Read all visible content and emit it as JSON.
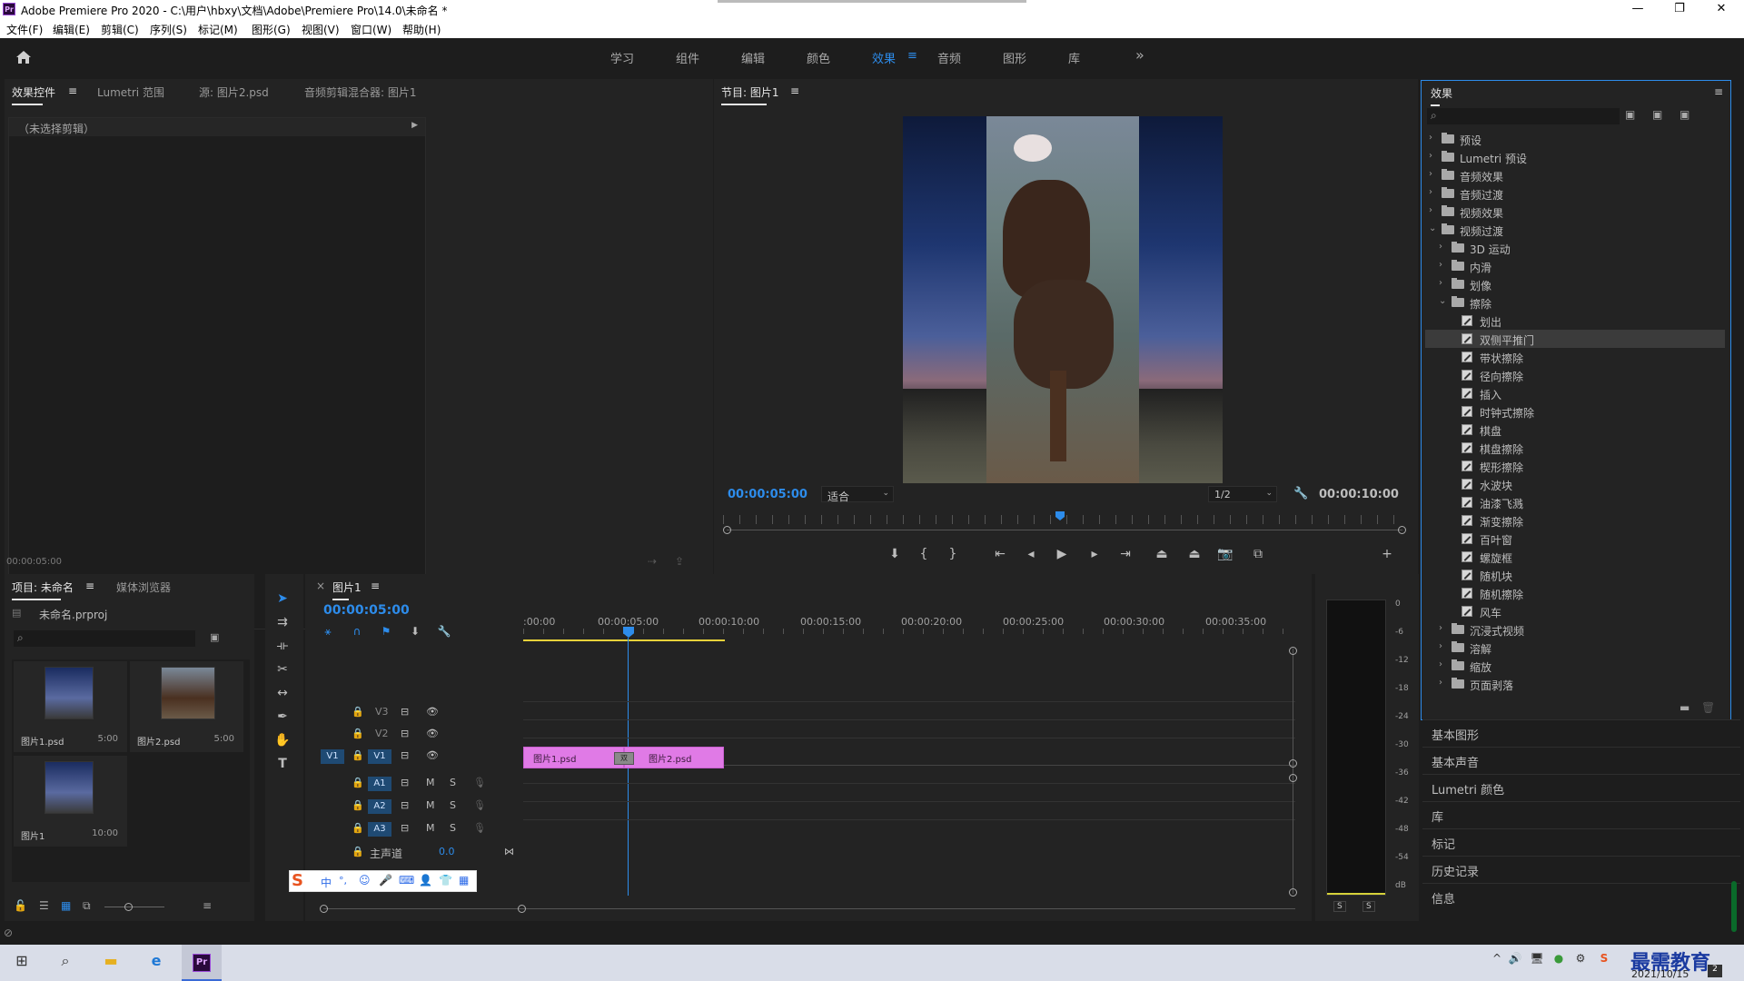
{
  "window": {
    "title": "Adobe Premiere Pro 2020 - C:\\用户\\hbxy\\文档\\Adobe\\Premiere Pro\\14.0\\未命名 *",
    "minimize": "—",
    "maximize": "❐",
    "close": "✕"
  },
  "menu": [
    "文件(F)",
    "编辑(E)",
    "剪辑(C)",
    "序列(S)",
    "标记(M)",
    "图形(G)",
    "视图(V)",
    "窗口(W)",
    "帮助(H)"
  ],
  "workspaces": {
    "items": [
      "学习",
      "组件",
      "编辑",
      "颜色",
      "效果",
      "音频",
      "图形",
      "库"
    ],
    "active": "效果",
    "more": "»",
    "menu_icon": "≡"
  },
  "effect_controls": {
    "tabs": [
      "效果控件",
      "Lumetri 范围",
      "源: 图片2.psd",
      "音频剪辑混合器: 图片1"
    ],
    "menu_icon": "≡",
    "no_clip": "（未选择剪辑）",
    "timecode": "00:00:05:00"
  },
  "program": {
    "title": "节目: 图片1",
    "menu_icon": "≡",
    "timecode": "00:00:05:00",
    "fit": "适合",
    "quality": "1/2",
    "duration": "00:00:10:00"
  },
  "project": {
    "tabs": [
      "项目: 未命名",
      "媒体浏览器"
    ],
    "menu_icon": "≡",
    "file": "未命名.prproj",
    "items": [
      {
        "name": "图片1.psd",
        "dur": "5:00"
      },
      {
        "name": "图片2.psd",
        "dur": "5:00"
      },
      {
        "name": "图片1",
        "dur": "10:00"
      }
    ]
  },
  "timeline": {
    "title": "图片1",
    "menu_icon": "≡",
    "close": "×",
    "timecode": "00:00:05:00",
    "ruler": [
      ":00:00",
      "00:00:05:00",
      "00:00:10:00",
      "00:00:15:00",
      "00:00:20:00",
      "00:00:25:00",
      "00:00:30:00",
      "00:00:35:00"
    ],
    "video_tracks": [
      "V3",
      "V2",
      "V1"
    ],
    "audio_tracks": [
      "A1",
      "A2",
      "A3"
    ],
    "src_patch": "V1",
    "master": "主声道",
    "master_val": "0.0",
    "clip1": "图片1.psd",
    "clip2": "图片2.psd",
    "transition_badge": "双"
  },
  "meter": {
    "scale": [
      "0",
      "-6",
      "-12",
      "-18",
      "-24",
      "-30",
      "-36",
      "-42",
      "-48",
      "-54",
      "dB"
    ],
    "solo": [
      "S",
      "S"
    ]
  },
  "effects": {
    "title": "效果",
    "menu_icon": "≡",
    "tree": [
      {
        "label": "预设",
        "level": 0,
        "type": "folder",
        "open": false
      },
      {
        "label": "Lumetri 预设",
        "level": 0,
        "type": "folder",
        "open": false
      },
      {
        "label": "音频效果",
        "level": 0,
        "type": "folder",
        "open": false
      },
      {
        "label": "音频过渡",
        "level": 0,
        "type": "folder",
        "open": false
      },
      {
        "label": "视频效果",
        "level": 0,
        "type": "folder",
        "open": false
      },
      {
        "label": "视频过渡",
        "level": 0,
        "type": "folder",
        "open": true
      },
      {
        "label": "3D 运动",
        "level": 1,
        "type": "folder",
        "open": false
      },
      {
        "label": "内滑",
        "level": 1,
        "type": "folder",
        "open": false
      },
      {
        "label": "划像",
        "level": 1,
        "type": "folder",
        "open": false
      },
      {
        "label": "擦除",
        "level": 1,
        "type": "folder",
        "open": true
      },
      {
        "label": "划出",
        "level": 2,
        "type": "fx"
      },
      {
        "label": "双侧平推门",
        "level": 2,
        "type": "fx",
        "selected": true
      },
      {
        "label": "带状擦除",
        "level": 2,
        "type": "fx"
      },
      {
        "label": "径向擦除",
        "level": 2,
        "type": "fx"
      },
      {
        "label": "插入",
        "level": 2,
        "type": "fx"
      },
      {
        "label": "时钟式擦除",
        "level": 2,
        "type": "fx"
      },
      {
        "label": "棋盘",
        "level": 2,
        "type": "fx"
      },
      {
        "label": "棋盘擦除",
        "level": 2,
        "type": "fx"
      },
      {
        "label": "楔形擦除",
        "level": 2,
        "type": "fx"
      },
      {
        "label": "水波块",
        "level": 2,
        "type": "fx"
      },
      {
        "label": "油漆飞溅",
        "level": 2,
        "type": "fx"
      },
      {
        "label": "渐变擦除",
        "level": 2,
        "type": "fx"
      },
      {
        "label": "百叶窗",
        "level": 2,
        "type": "fx"
      },
      {
        "label": "螺旋框",
        "level": 2,
        "type": "fx"
      },
      {
        "label": "随机块",
        "level": 2,
        "type": "fx"
      },
      {
        "label": "随机擦除",
        "level": 2,
        "type": "fx"
      },
      {
        "label": "风车",
        "level": 2,
        "type": "fx"
      },
      {
        "label": "沉浸式视频",
        "level": 1,
        "type": "folder",
        "open": false
      },
      {
        "label": "溶解",
        "level": 1,
        "type": "folder",
        "open": false
      },
      {
        "label": "缩放",
        "level": 1,
        "type": "folder",
        "open": false
      },
      {
        "label": "页面剥落",
        "level": 1,
        "type": "folder",
        "open": false
      }
    ]
  },
  "collapsed_panels": [
    "基本图形",
    "基本声音",
    "Lumetri 颜色",
    "库",
    "标记",
    "历史记录",
    "信息"
  ],
  "ime": {
    "items": [
      "S",
      "中",
      "°,",
      "☺",
      "🎤",
      "⌨",
      "👤",
      "👕",
      "▦"
    ]
  },
  "taskbar": {
    "date": "2021/10/15",
    "watermark": "最需教育",
    "notif": "2"
  }
}
